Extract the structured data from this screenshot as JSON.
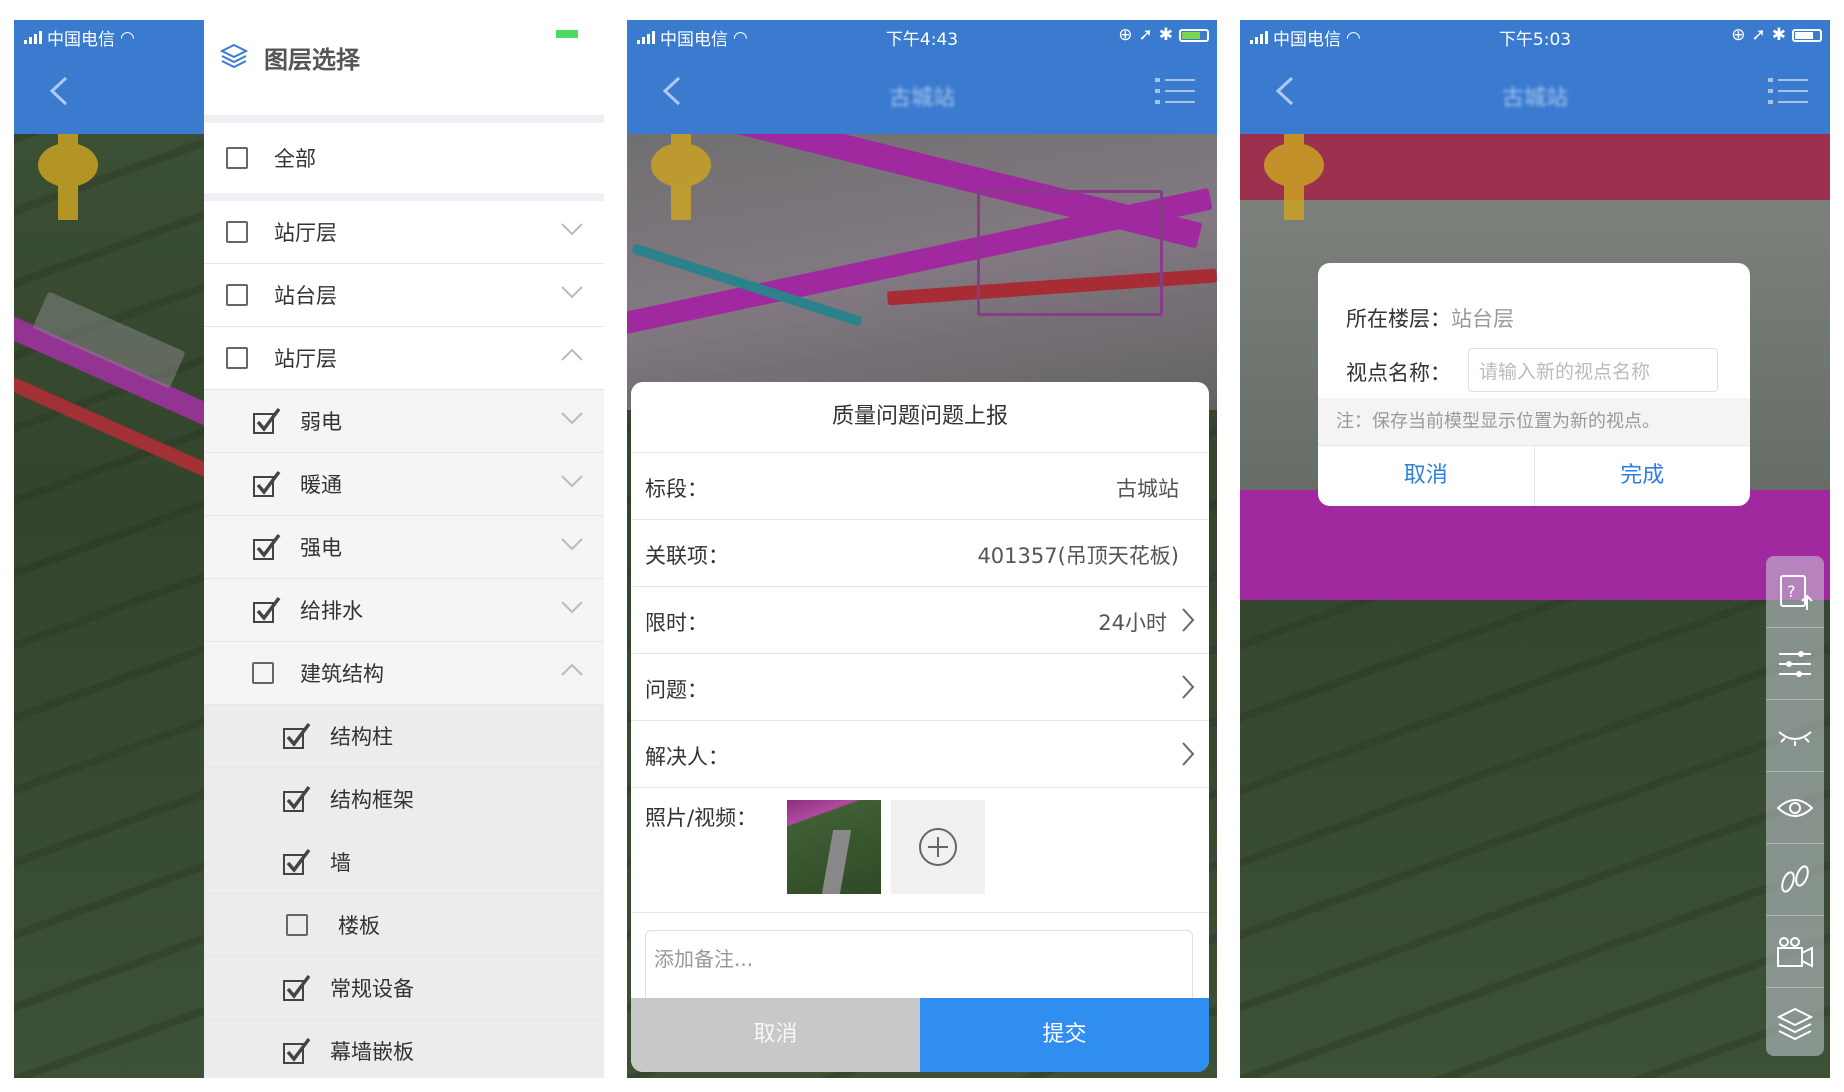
{
  "panel1": {
    "drawer_title": "图层选择",
    "all_label": "全部",
    "categories": [
      {
        "label": "站厅层",
        "expanded": false,
        "checked": false
      },
      {
        "label": "站台层",
        "expanded": false,
        "checked": false
      },
      {
        "label": "站厅层",
        "expanded": true,
        "checked": false
      }
    ],
    "subcategories": [
      {
        "label": "弱电",
        "checked": true
      },
      {
        "label": "暖通",
        "checked": true
      },
      {
        "label": "强电",
        "checked": true
      },
      {
        "label": "给排水",
        "checked": true
      },
      {
        "label": "建筑结构",
        "checked": false,
        "expanded": true
      }
    ],
    "items": [
      {
        "label": "结构柱",
        "checked": true
      },
      {
        "label": "结构框架",
        "checked": true
      },
      {
        "label": "墙",
        "checked": true
      },
      {
        "label": "楼板",
        "checked": false
      },
      {
        "label": "常规设备",
        "checked": true
      },
      {
        "label": "幕墙嵌板",
        "checked": true
      }
    ],
    "carrier": "中国电信"
  },
  "panel2": {
    "carrier": "中国电信",
    "time": "下午4:43",
    "nav_title": "古城站",
    "form_title": "质量问题问题上报",
    "fields": [
      {
        "key": "标段：",
        "value": "古城站",
        "arrow": false
      },
      {
        "key": "关联项：",
        "value": "401357(吊顶天花板)",
        "arrow": false
      },
      {
        "key": "限时：",
        "value": "24小时",
        "arrow": true
      },
      {
        "key": "问题：",
        "value": "",
        "arrow": true
      },
      {
        "key": "解决人：",
        "value": "",
        "arrow": true
      }
    ],
    "photos_label": "照片/视频：",
    "remark_placeholder": "添加备注...",
    "cancel_label": "取消",
    "submit_label": "提交"
  },
  "panel3": {
    "carrier": "中国电信",
    "time": "下午5:03",
    "nav_title": "古城站",
    "floor_label": "所在楼层：",
    "floor_value": "站台层",
    "name_label": "视点名称：",
    "name_placeholder": "请输入新的视点名称",
    "note": "注：保存当前模型显示位置为新的视点。",
    "cancel_label": "取消",
    "done_label": "完成",
    "tools": [
      "question-upload-icon",
      "sliders-icon",
      "eye-closed-icon",
      "eye-icon",
      "footsteps-icon",
      "video-camera-icon",
      "layers-icon"
    ]
  },
  "colors": {
    "nav_blue": "#3a7bd0",
    "accent_blue": "#2f8ef0",
    "magenta_pipe": "#d61fd6",
    "red_pipe": "#e0242e"
  }
}
